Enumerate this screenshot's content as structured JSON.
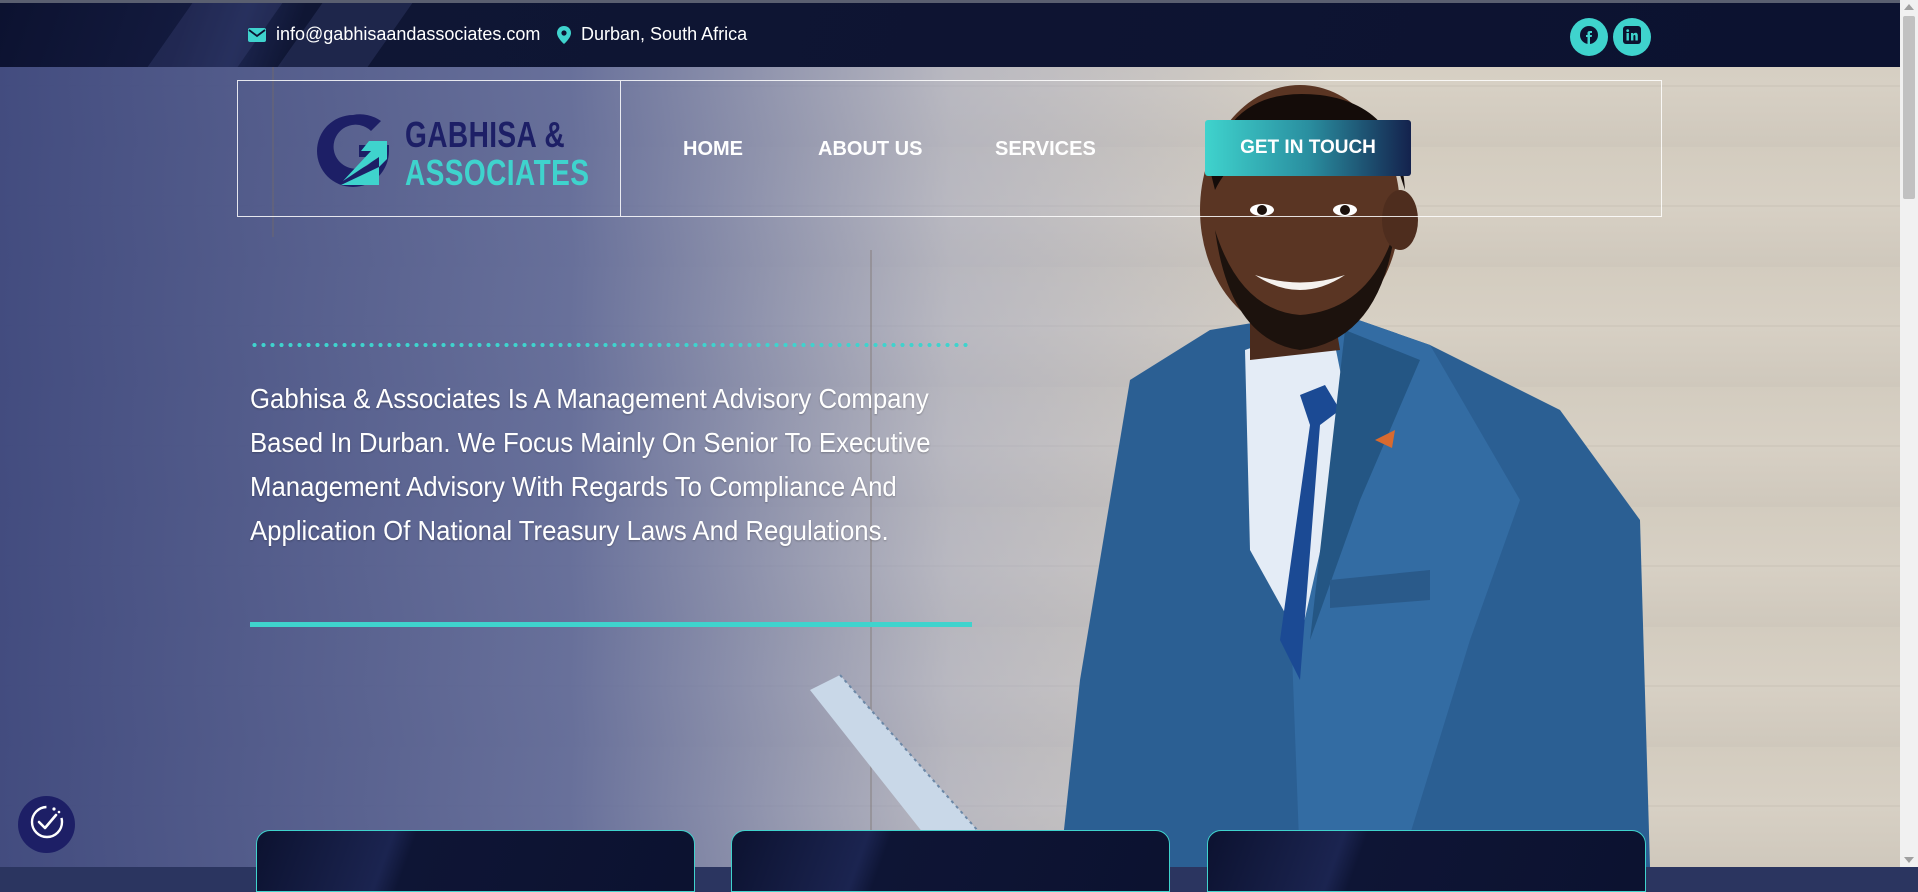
{
  "topbar": {
    "email": "info@gabhisaandassociates.com",
    "email_icon": "envelope-icon",
    "location": "Durban, South Africa",
    "location_icon": "map-pin-icon",
    "social": [
      "facebook-icon",
      "linkedin-icon"
    ]
  },
  "logo": {
    "line1": "GABHISA &",
    "line2": "ASSOCIATES",
    "mark": "G"
  },
  "nav": {
    "items": [
      "HOME",
      "ABOUT US",
      "SERVICES"
    ],
    "cta": "GET IN TOUCH"
  },
  "hero": {
    "text": "Gabhisa & Associates Is A Management Advisory Company Based In Durban. We Focus Mainly On Senior To Executive Management Advisory With Regards To Compliance And Application Of National Treasury Laws And Regulations."
  },
  "colors": {
    "accent": "#3fd3cd",
    "navy": "#1d1f66",
    "dark": "#0c1230"
  },
  "accessibility_icon": "accessibility-check-icon"
}
